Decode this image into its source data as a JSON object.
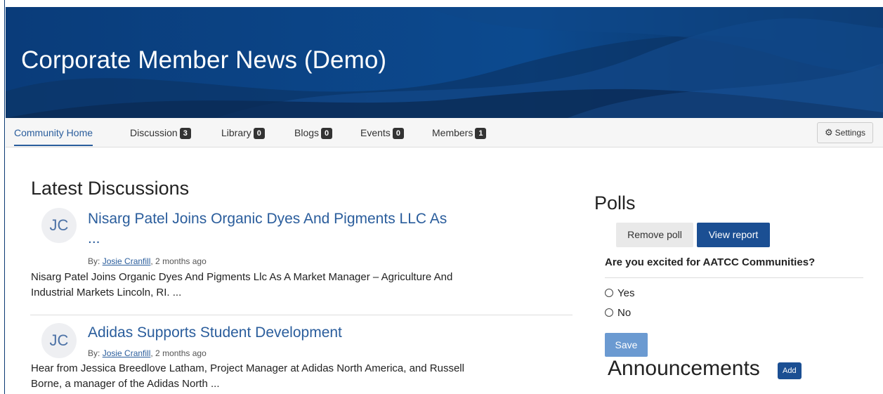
{
  "banner": {
    "title": "Corporate Member News (Demo)"
  },
  "nav": {
    "items": [
      {
        "label": "Community Home",
        "badge": null
      },
      {
        "label": "Discussion",
        "badge": "3"
      },
      {
        "label": "Library",
        "badge": "0"
      },
      {
        "label": "Blogs",
        "badge": "0"
      },
      {
        "label": "Events",
        "badge": "0"
      },
      {
        "label": "Members",
        "badge": "1"
      }
    ],
    "settings_label": "Settings",
    "settings_icon": "gear-icon"
  },
  "discussions": {
    "heading": "Latest Discussions",
    "posts": [
      {
        "initials": "JC",
        "title_line1": "Nisarg Patel Joins Organic Dyes And Pigments LLC As",
        "title_line2": "...",
        "by_label": "By:",
        "author": "Josie Cranfill",
        "time": ", 2 months ago",
        "excerpt_line1": "Nisarg Patel Joins Organic Dyes And Pigments Llc As A Market Manager – Agriculture And",
        "excerpt_line2": "Industrial Markets Lincoln, RI. ..."
      },
      {
        "initials": "JC",
        "title_line1": "Adidas Supports Student Development",
        "by_label": "By:",
        "author": "Josie Cranfill",
        "time": ", 2 months ago",
        "excerpt_line1": "Hear from Jessica Breedlove Latham, Project Manager at Adidas North America, and Russell",
        "excerpt_line2": "Borne, a manager of the Adidas North ..."
      }
    ]
  },
  "polls": {
    "heading": "Polls",
    "remove_label": "Remove poll",
    "report_label": "View report",
    "question": "Are you excited for AATCC Communities?",
    "options": [
      "Yes",
      "No"
    ],
    "save_label": "Save"
  },
  "announcements": {
    "heading": "Announcements",
    "add_label": "Add"
  },
  "colors": {
    "accent": "#2a5d9c",
    "primary_button": "#1b4f93",
    "banner": "#0b3d7a",
    "badge": "#333333"
  }
}
